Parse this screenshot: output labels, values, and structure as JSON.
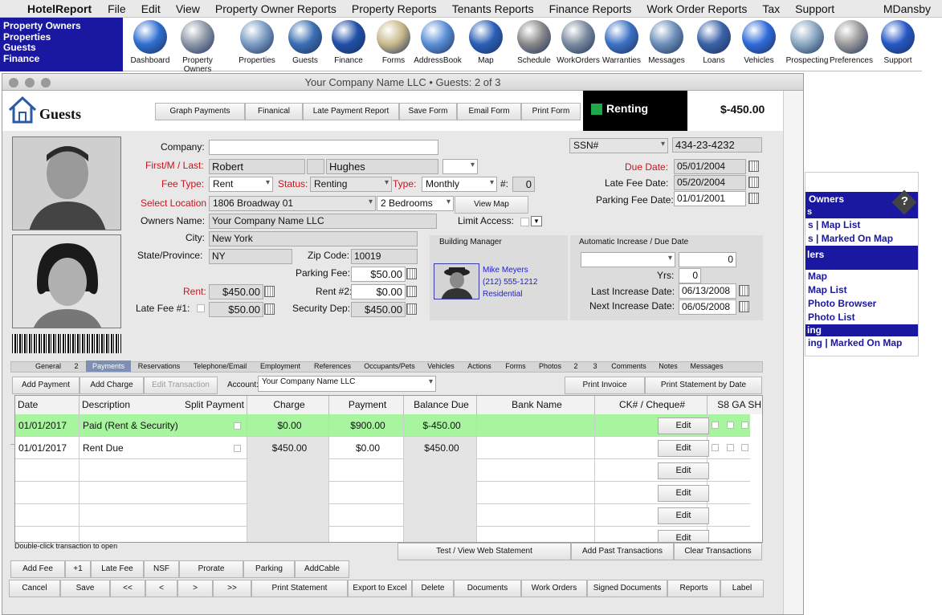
{
  "menubar": {
    "app": "HotelReport",
    "items": [
      "File",
      "Edit",
      "View",
      "Property Owner Reports",
      "Property Reports",
      "Tenants Reports",
      "Finance Reports",
      "Work Order Reports",
      "Tax",
      "Support"
    ],
    "user": "MDansby"
  },
  "quicklinks": [
    "Property Owners",
    "Properties",
    "Guests",
    "Finance"
  ],
  "toolbar": [
    {
      "label": "Dashboard",
      "icon": "globe-icon",
      "color": "#2f6fd0"
    },
    {
      "label": "Property Owners",
      "icon": "building-icon",
      "color": "#8c96a6"
    },
    {
      "label": "Properties",
      "icon": "house-icon",
      "color": "#7a9cc4"
    },
    {
      "label": "Guests",
      "icon": "people-icon",
      "color": "#3b6fb3"
    },
    {
      "label": "Finance",
      "icon": "bank-icon",
      "color": "#1f4fa8"
    },
    {
      "label": "Forms",
      "icon": "document-icon",
      "color": "#c9b98a"
    },
    {
      "label": "AddressBook",
      "icon": "at-sign-icon",
      "color": "#5b8fd6"
    },
    {
      "label": "Map",
      "icon": "globe-map-icon",
      "color": "#2a5fb8"
    },
    {
      "label": "Schedule",
      "icon": "calendar-icon",
      "color": "#888888"
    },
    {
      "label": "WorkOrders",
      "icon": "tools-icon",
      "color": "#7b8aa0"
    },
    {
      "label": "Warranties",
      "icon": "warranty-badge-icon",
      "color": "#3c72c4"
    },
    {
      "label": "Messages",
      "icon": "telephone-icon",
      "color": "#6c8fb8"
    },
    {
      "label": "Loans",
      "icon": "hourglass-icon",
      "color": "#3a62a8"
    },
    {
      "label": "Vehicles",
      "icon": "car-icon",
      "color": "#2f6ad8"
    },
    {
      "label": "Prospecting",
      "icon": "towers-icon",
      "color": "#8aa7c2"
    },
    {
      "label": "Preferences",
      "icon": "wrench-icon",
      "color": "#999999"
    },
    {
      "label": "Support",
      "icon": "question-icon",
      "color": "#2457c5"
    }
  ],
  "rightpanel": {
    "header": "Owners",
    "header_prefix": "s",
    "links1": [
      "s | Map List",
      "s | Marked On Map"
    ],
    "bar2": "lers",
    "links2": [
      "Map",
      "Map List",
      "Photo Browser",
      "Photo List"
    ],
    "bar3": "ing",
    "links3": [
      "ing | Marked On Map"
    ]
  },
  "window": {
    "title": "Your Company Name LLC  •  Guests: 2 of 3",
    "section": "Guests",
    "top_buttons": [
      "Graph Payments",
      "Finanical",
      "Late Payment Report",
      "Save Form",
      "Email Form",
      "Print Form"
    ],
    "status": "Renting",
    "amount": "$-450.00"
  },
  "form": {
    "company_label": "Company:",
    "company": "",
    "name_label": "First/M / Last:",
    "first": "Robert",
    "middle": "",
    "last": "Hughes",
    "suffix": "",
    "feetype_label": "Fee Type:",
    "feetype": "Rent",
    "status_label": "Status:",
    "status": "Renting",
    "type_label": "Type:",
    "type": "Monthly",
    "num_label": "#:",
    "num": "0",
    "location_label": "Select Location",
    "location": "1806 Broadway 01",
    "bedrooms": "2 Bedrooms",
    "view_map": "View Map",
    "owners_label": "Owners Name:",
    "owners": "Your Company Name LLC",
    "limit_label": "Limit Access:",
    "city_label": "City:",
    "city": "New York",
    "state_label": "State/Province:",
    "state": "NY",
    "zip_label": "Zip Code:",
    "zip": "10019",
    "parking_label": "Parking Fee:",
    "parking": "$50.00",
    "rent_label": "Rent:",
    "rent": "$450.00",
    "rent2_label": "Rent #2:",
    "rent2": "$0.00",
    "latefee1_label": "Late Fee #1:",
    "latefee1": "$50.00",
    "security_label": "Security Dep:",
    "security": "$450.00",
    "ssn_type": "SSN#",
    "ssn": "434-23-4232",
    "due_label": "Due Date:",
    "due": "05/01/2004",
    "latedate_label": "Late Fee Date:",
    "latedate": "05/20/2004",
    "parkingdate_label": "Parking Fee Date:",
    "parkingdate": "01/01/2001",
    "bm_title": "Building Manager",
    "bm_name": "Mike Meyers",
    "bm_phone": "(212) 555-1212",
    "bm_type": "Residential",
    "auto_title": "Automatic Increase / Due Date",
    "auto_select": "",
    "auto_value": "0",
    "yrs_label": "Yrs:",
    "yrs": "0",
    "lastinc_label": "Last Increase Date:",
    "lastinc": "06/13/2008",
    "nextinc_label": "Next Increase Date:",
    "nextinc": "06/05/2008"
  },
  "tabs": [
    "General",
    "2",
    "Payments",
    "Reservations",
    "Telephone/Email",
    "Employment",
    "References",
    "Occupants/Pets",
    "Vehicles",
    "Actions",
    "Forms",
    "Photos",
    "2",
    "3",
    "Comments",
    "Notes",
    "Messages"
  ],
  "active_tab": "Payments",
  "payments": {
    "add_payment": "Add Payment",
    "add_charge": "Add Charge",
    "edit_transaction": "Edit Transaction",
    "account_label": "Account:",
    "account": "Your Company Name LLC",
    "print_invoice": "Print Invoice",
    "print_statement_date": "Print Statement by Date",
    "columns": [
      "Date",
      "Description",
      "Split Payment",
      "Charge",
      "Payment",
      "Balance Due",
      "Bank Name",
      "CK# / Cheque#",
      "S8 GA SH"
    ],
    "rows": [
      {
        "date": "01/01/2017",
        "desc": "Paid (Rent & Security)",
        "charge": "$0.00",
        "payment": "$900.00",
        "balance": "$-450.00",
        "highlight": true
      },
      {
        "date": "01/01/2017",
        "desc": "Rent Due",
        "charge": "$450.00",
        "payment": "$0.00",
        "balance": "$450.00",
        "highlight": false
      },
      {
        "date": "",
        "desc": "",
        "charge": "",
        "payment": "",
        "balance": "",
        "highlight": false
      },
      {
        "date": "",
        "desc": "",
        "charge": "",
        "payment": "",
        "balance": "",
        "highlight": false
      },
      {
        "date": "",
        "desc": "",
        "charge": "",
        "payment": "",
        "balance": "",
        "highlight": false
      },
      {
        "date": "",
        "desc": "",
        "charge": "",
        "payment": "",
        "balance": "",
        "highlight": false
      }
    ],
    "edit_label": "Edit",
    "hint": "Double-click transaction to open",
    "test_web": "Test / View Web Statement",
    "add_past": "Add Past Transactions",
    "clear": "Clear Transactions"
  },
  "bottom1": [
    "Add Fee",
    "+1",
    "Late Fee",
    "NSF",
    "Prorate",
    "Parking",
    "AddCable"
  ],
  "bottom2": [
    "Cancel",
    "Save",
    "<<",
    "<",
    ">",
    ">>",
    "Print Statement",
    "Export to Excel",
    "Delete",
    "Documents",
    "Work Orders",
    "Signed Documents",
    "Reports",
    "Label"
  ]
}
